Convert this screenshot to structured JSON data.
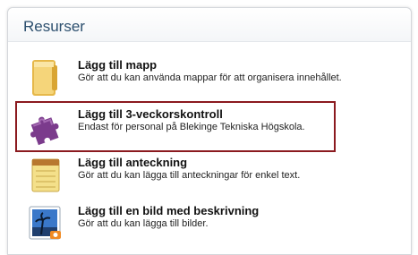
{
  "panel": {
    "title": "Resurser",
    "items": [
      {
        "title": "Lägg till mapp",
        "description": "Gör att du kan använda mappar för att organisera innehållet.",
        "icon": "folder-icon"
      },
      {
        "title": "Lägg till 3-veckorskontroll",
        "description": "Endast för personal på Blekinge Tekniska Högskola.",
        "icon": "puzzle-piece-icon"
      },
      {
        "title": "Lägg till anteckning",
        "description": "Gör att du kan lägga till anteckningar för enkel text.",
        "icon": "notepad-icon"
      },
      {
        "title": "Lägg till en bild med beskrivning",
        "description": "Gör att du kan lägga till bilder.",
        "icon": "picture-icon"
      }
    ]
  },
  "colors": {
    "title": "#2c4f6e",
    "highlight_border": "#8b1a1f"
  }
}
